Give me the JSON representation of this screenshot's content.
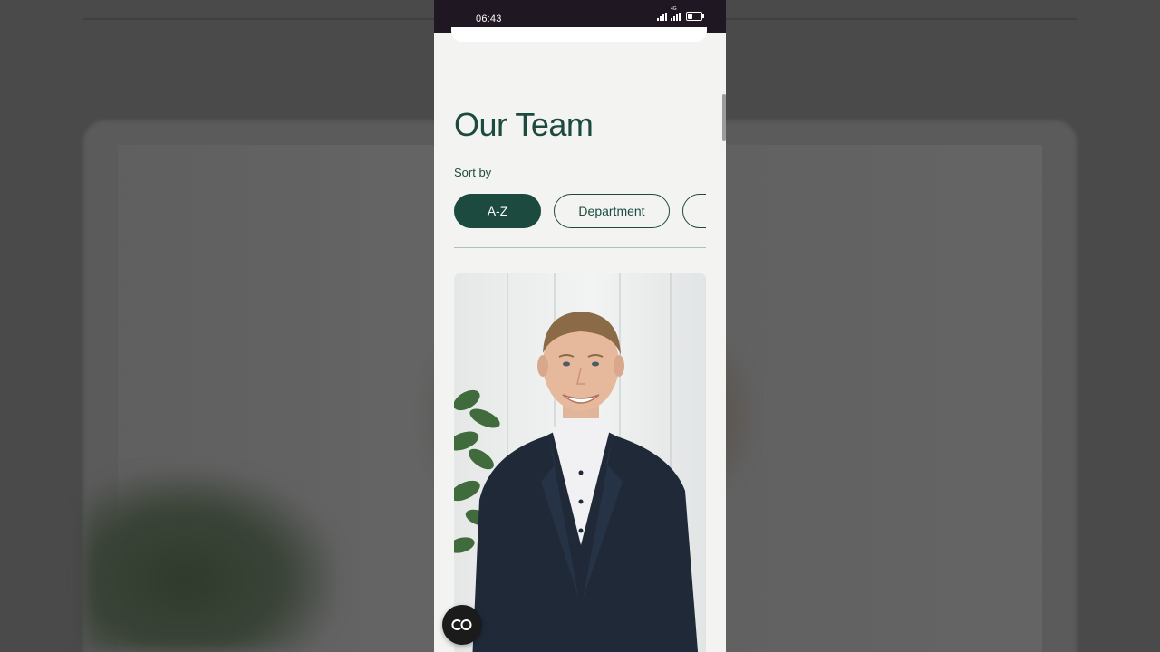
{
  "status_bar": {
    "time": "06:43",
    "network_label": "4G",
    "battery_level": 0.35
  },
  "page": {
    "title": "Our Team",
    "sort_label": "Sort by",
    "sort_options": [
      {
        "label": "A-Z",
        "active": true
      },
      {
        "label": "Department",
        "active": false
      },
      {
        "label": "",
        "active": false
      }
    ]
  },
  "floating_button": {
    "icon": "collab-logo-icon"
  },
  "colors": {
    "brand_green": "#1c4a3f",
    "status_bar": "#1f1722",
    "page_background": "#f3f4f2"
  }
}
